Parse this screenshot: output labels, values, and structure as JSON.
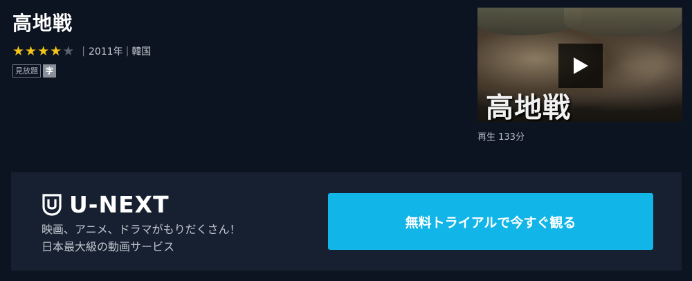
{
  "title": "高地戦",
  "rating": {
    "value": 4,
    "max": 5
  },
  "meta": {
    "year": "2011年",
    "country": "韓国"
  },
  "badges": {
    "unlimited": "見放題",
    "subtitle": "字"
  },
  "thumbnail": {
    "overlay_title": "高地戦"
  },
  "duration": "再生 133分",
  "promo": {
    "logo_text": "U-NEXT",
    "tagline_line1": "映画、アニメ、ドラマがもりだくさん！",
    "tagline_line2": "日本最大級の動画サービス",
    "cta_label": "無料トライアルで今すぐ観る"
  },
  "colors": {
    "background": "#0c1321",
    "promo_panel": "#162030",
    "cta": "#12b5e7",
    "star_on": "#f5c518",
    "star_off": "#5a6170"
  },
  "icons": [
    "star-icon",
    "play-icon",
    "u-next-shield-icon"
  ]
}
